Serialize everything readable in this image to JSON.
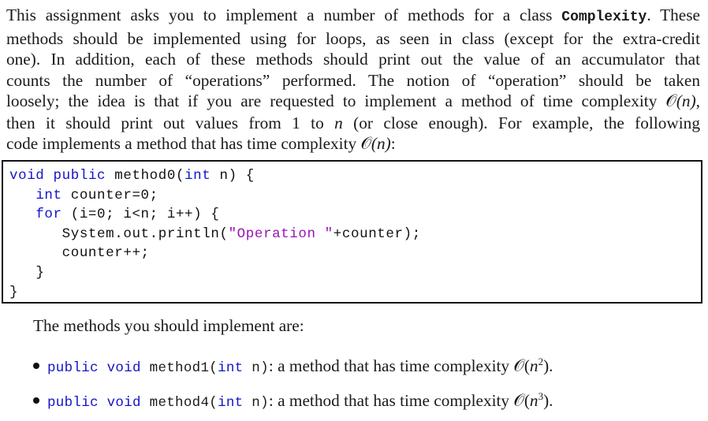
{
  "intro": {
    "lines": [
      {
        "before": "This assignment asks you to implement a number of methods for a class ",
        "code": "Complexity",
        "after": ". These"
      },
      {
        "text": "methods should be implemented using for loops, as seen in class (except for the extra-credit"
      },
      {
        "text": "one). In addition, each of these methods should print out the value of an accumulator that"
      },
      {
        "text": "counts the number of “operations” performed. The notion of “operation” should be taken"
      },
      {
        "before": "loosely; the idea is that if you are requested to implement a method of time complexity ",
        "math": "(n)",
        "after": ","
      },
      {
        "before": "then it should print out values from 1 to ",
        "var": "n",
        "after": " (or close enough). For example, the following"
      },
      {
        "before": "code implements a method that has time complexity ",
        "math": "(n)",
        "after": ":"
      }
    ],
    "bigO_symbol": "𝒪"
  },
  "code_example": {
    "lines": [
      {
        "kw1": "void",
        "sp1": " ",
        "kw2": "public",
        "rest": " method0(",
        "kw3": "int",
        "rest2": " n) {"
      },
      {
        "indent": "   ",
        "kw1": "int",
        "rest": " counter=0;"
      },
      {
        "indent": "   ",
        "kw1": "for",
        "rest": " (i=0; i<n; i++) {"
      },
      {
        "indent": "      ",
        "rest": "System.out.println(",
        "str": "\"Operation \"",
        "rest2": "+counter);"
      },
      {
        "indent": "      ",
        "rest": "counter++;"
      },
      {
        "indent": "   ",
        "rest": "}"
      },
      {
        "rest": "}"
      }
    ]
  },
  "methods_heading": "The methods you should implement are:",
  "methods": [
    {
      "kw1": "public",
      "kw2": "void",
      "name": "method1(",
      "kw3": "int",
      "param": " n)",
      "desc": ": a method that has time complexity ",
      "exp": "2",
      "end": "."
    },
    {
      "kw1": "public",
      "kw2": "void",
      "name": "method4(",
      "kw3": "int",
      "param": " n)",
      "desc": ": a method that has time complexity ",
      "exp": "3",
      "end": "."
    }
  ],
  "colors": {
    "keyword": "#1414c8",
    "string": "#9a14b4",
    "text": "#1a1a1a",
    "frame": "#111111"
  }
}
